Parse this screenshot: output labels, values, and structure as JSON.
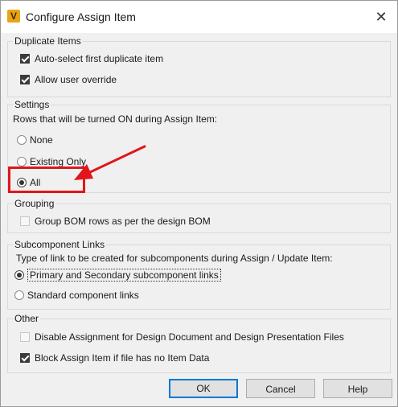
{
  "window": {
    "title": "Configure Assign Item",
    "icon": "V",
    "close_glyph": "✕"
  },
  "duplicate_items": {
    "legend": "Duplicate Items",
    "auto_select": {
      "label": "Auto-select first duplicate item",
      "checked": true
    },
    "allow_override": {
      "label": "Allow user override",
      "checked": true
    }
  },
  "settings": {
    "legend": "Settings",
    "description": "Rows that will be turned ON during Assign Item:",
    "options": [
      {
        "label": "None",
        "selected": false
      },
      {
        "label": "Existing Only",
        "selected": false
      },
      {
        "label": "All",
        "selected": true
      }
    ]
  },
  "grouping": {
    "legend": "Grouping",
    "group_bom": {
      "label": "Group BOM rows as per the design BOM",
      "checked": false,
      "enabled": false
    }
  },
  "subcomponent_links": {
    "legend": "Subcomponent Links",
    "description": "Type of link to be created for subcomponents during Assign / Update Item:",
    "options": [
      {
        "label": "Primary and Secondary subcomponent links",
        "selected": true
      },
      {
        "label": "Standard component links",
        "selected": false
      }
    ]
  },
  "other": {
    "legend": "Other",
    "disable_assignment": {
      "label": "Disable Assignment for Design Document and Design Presentation Files",
      "checked": false,
      "enabled": false
    },
    "block_assign": {
      "label": "Block Assign Item if file has no Item Data",
      "checked": true
    }
  },
  "buttons": {
    "ok": "OK",
    "cancel": "Cancel",
    "help": "Help"
  },
  "colors": {
    "annotation": "#e0161b",
    "default_button_border": "#0078d7"
  }
}
